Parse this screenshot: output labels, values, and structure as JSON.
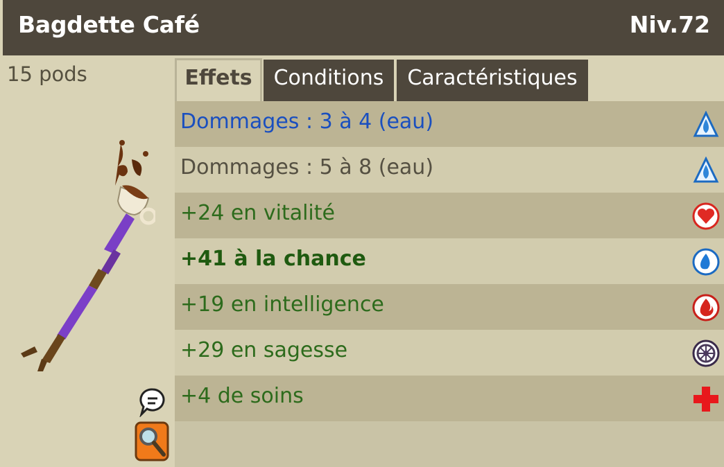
{
  "item": {
    "name": "Bagdette Café",
    "level": "Niv.72",
    "weight": "15 pods"
  },
  "tabs": [
    {
      "label": "Effets",
      "active": true
    },
    {
      "label": "Conditions",
      "active": false
    },
    {
      "label": "Caractéristiques",
      "active": false
    }
  ],
  "effects": [
    {
      "text": "Dommages : 3 à 4 (eau)",
      "icon": "water-drop-outline-icon",
      "color": "#1a4fbf"
    },
    {
      "text": "Dommages : 5 à 8 (eau)",
      "icon": "water-drop-outline-icon",
      "color": "#555042"
    },
    {
      "text": "+24 en vitalité",
      "icon": "heart-icon",
      "color": "#2d6b1c"
    },
    {
      "text": "+41 à la chance",
      "icon": "water-drop-icon",
      "color": "#1f5a10"
    },
    {
      "text": "+19 en intelligence",
      "icon": "fire-icon",
      "color": "#2d6b1c"
    },
    {
      "text": "+29 en sagesse",
      "icon": "wisdom-icon",
      "color": "#2d6b1c"
    },
    {
      "text": "+4 de soins",
      "icon": "red-cross-icon",
      "color": "#2d6b1c"
    }
  ],
  "colors": {
    "header_bg": "#4e473c",
    "panel_bg": "#d9d3b6",
    "row_dark": "#bcb494",
    "row_light": "#d2ccae"
  }
}
